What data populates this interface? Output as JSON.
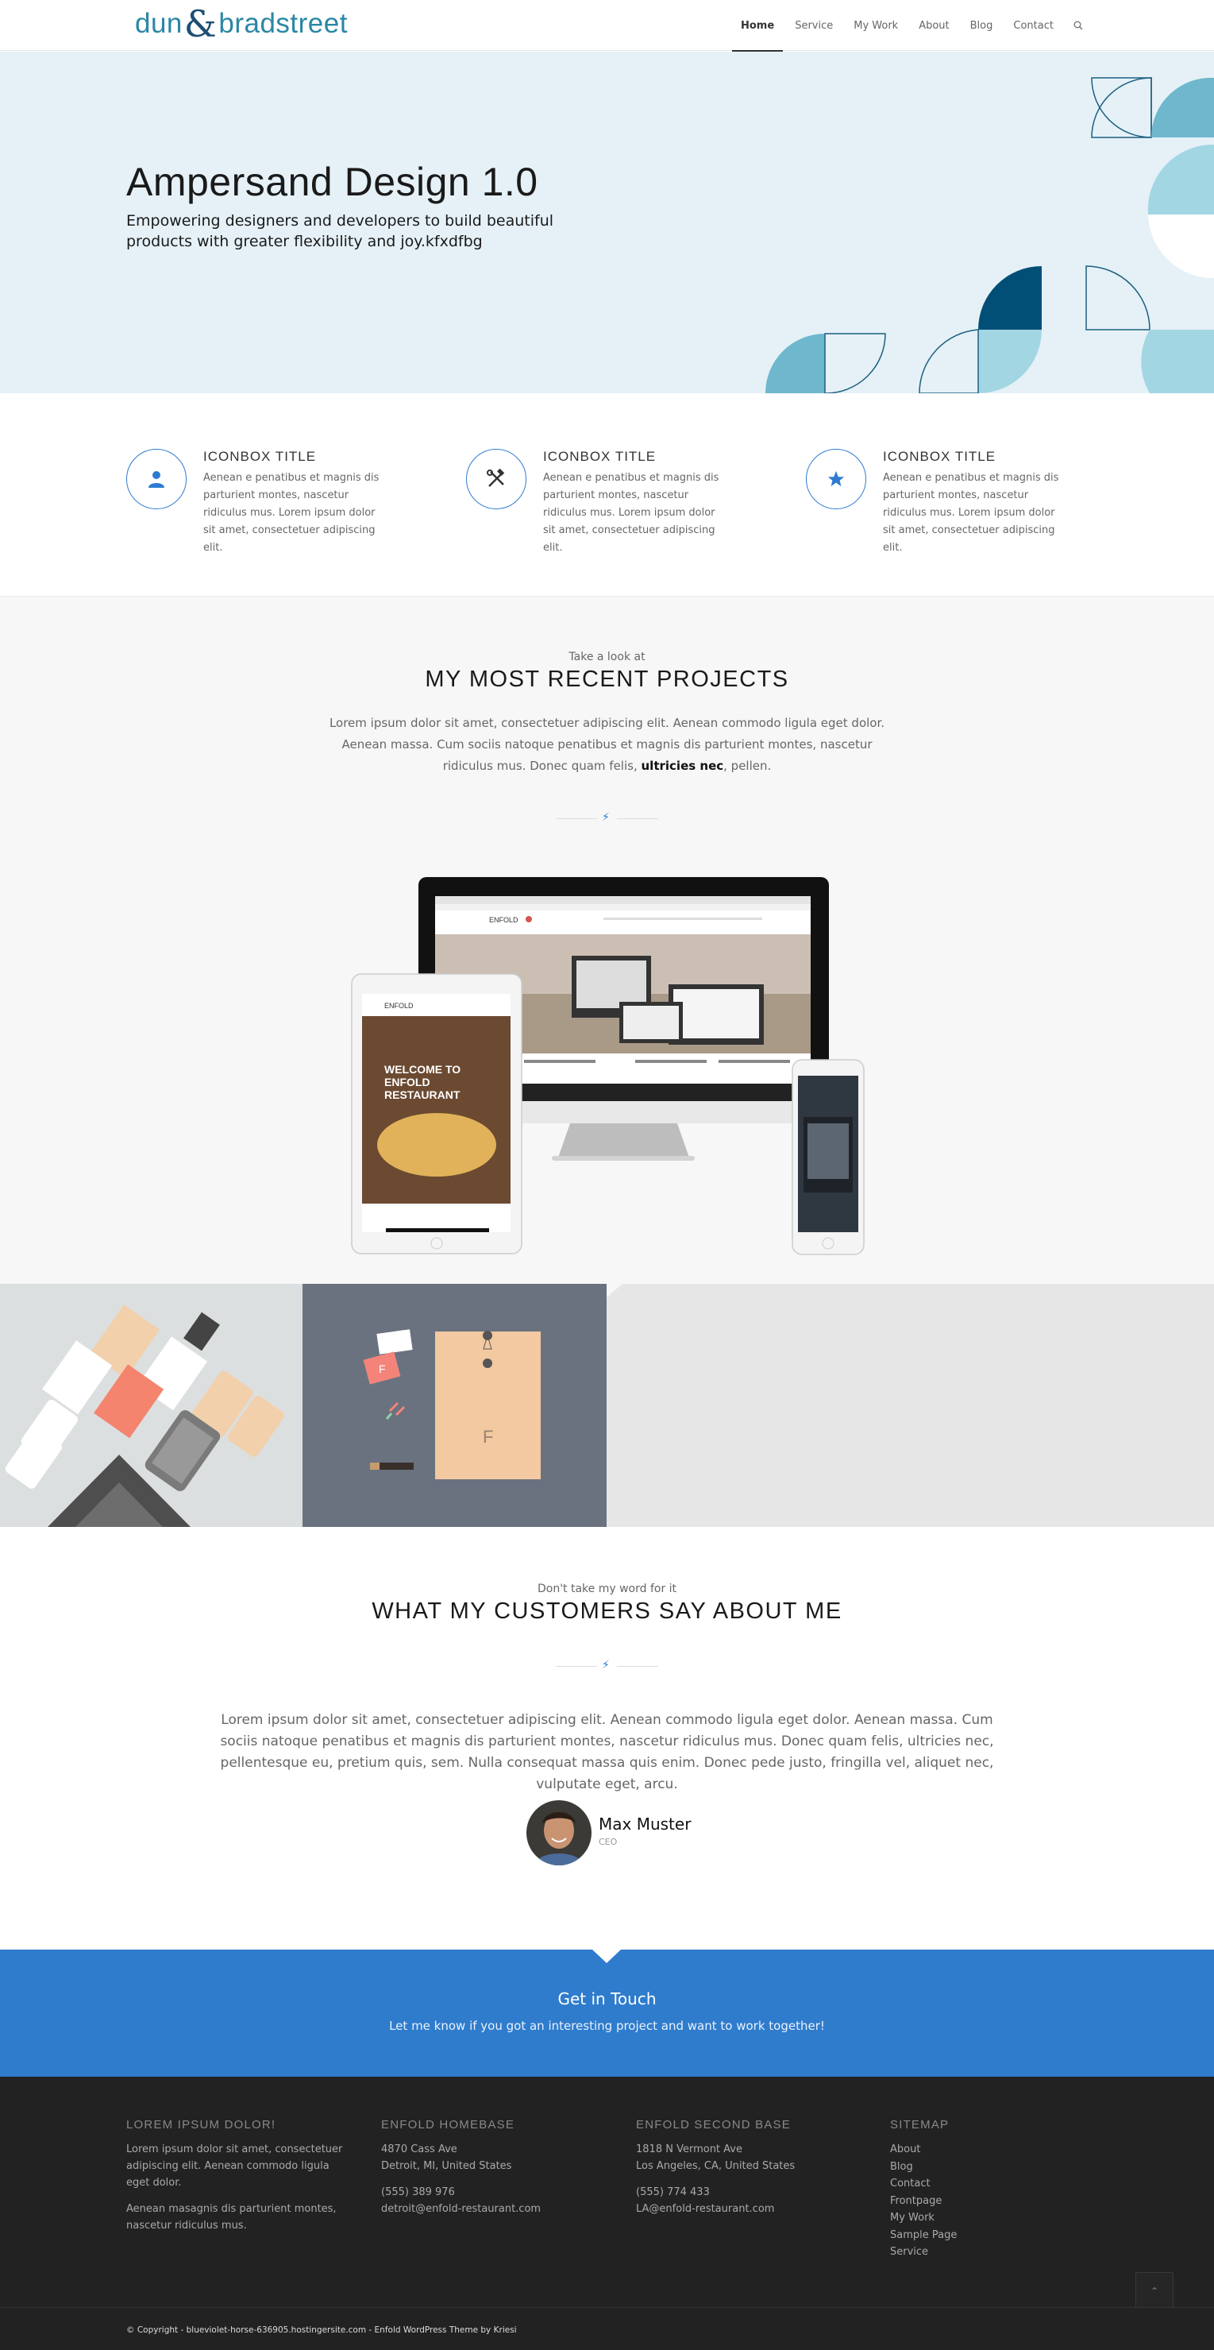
{
  "header": {
    "logo": {
      "left": "dun",
      "amp": "&",
      "right": "bradstreet"
    },
    "nav": [
      "Home",
      "Service",
      "My Work",
      "About",
      "Blog",
      "Contact"
    ],
    "search_icon": "search-icon"
  },
  "hero": {
    "title": "Ampersand Design 1.0",
    "subtitle": "Empowering designers and developers to build beautiful products with greater flexibility and joy.kfxdfbg"
  },
  "iconboxes": [
    {
      "icon": "user-icon",
      "title": "ICONBOX TITLE",
      "text": "Aenean e penatibus et magnis dis parturient montes, nascetur ridiculus mus. Lorem ipsum dolor sit amet, consectetuer adipiscing elit."
    },
    {
      "icon": "tools-icon",
      "title": "ICONBOX TITLE",
      "text": "Aenean e penatibus et magnis dis parturient montes, nascetur ridiculus mus. Lorem ipsum dolor sit amet, consectetuer adipiscing elit."
    },
    {
      "icon": "star-icon",
      "title": "ICONBOX TITLE",
      "text": "Aenean e penatibus et magnis dis parturient montes, nascetur ridiculus mus. Lorem ipsum dolor sit amet, consectetuer adipiscing elit."
    }
  ],
  "projects": {
    "kicker": "Take a look at",
    "title": "MY MOST RECENT PROJECTS",
    "lead_a": "Lorem ipsum dolor sit amet, consectetuer adipiscing elit. Aenean commodo ligula eget dolor. Aenean massa. Cum sociis natoque penatibus et magnis dis parturient montes, nascetur ridiculus mus. Donec quam felis, ",
    "lead_bold": "ultricies nec",
    "lead_b": ", pellen.",
    "divider_icon": "lightning-icon",
    "screen": {
      "logo": "ENFOLD",
      "tablet_welcome": "WELCOME TO ENFOLD RESTAURANT"
    }
  },
  "gallery": {
    "tiles": [
      "branding-tags-photo",
      "stationery-envelope-photo",
      "empty-gray-tile"
    ]
  },
  "testimonials": {
    "kicker": "Don't take my word for it",
    "title": "WHAT MY CUSTOMERS SAY ABOUT ME",
    "quote": "Lorem ipsum dolor sit amet, consectetuer adipiscing elit. Aenean commodo ligula eget dolor. Aenean massa. Cum sociis natoque penatibus et magnis dis parturient montes, nascetur ridiculus mus. Donec quam felis, ultricies nec, pellentesque eu, pretium quis, sem. Nulla consequat massa quis enim. Donec pede justo, fringilla vel, aliquet nec, vulputate eget, arcu.",
    "name": "Max Muster",
    "role": "CEO"
  },
  "cta": {
    "title": "Get in Touch",
    "text": "Let me know if you got an interesting project and want to work together!"
  },
  "footer": {
    "col1": {
      "title": "LOREM IPSUM DOLOR!",
      "p1": "Lorem ipsum dolor sit amet, consectetuer adipiscing elit. Aenean commodo ligula eget dolor.",
      "p2": "Aenean masagnis dis parturient montes, nascetur ridiculus mus."
    },
    "col2": {
      "title": "ENFOLD HOMEBASE",
      "addr1": "4870 Cass Ave",
      "addr2": "Detroit, MI, United States",
      "phone": "(555) 389 976",
      "email": "detroit@enfold-restaurant.com"
    },
    "col3": {
      "title": "ENFOLD SECOND BASE",
      "addr1": "1818 N Vermont Ave",
      "addr2": "Los Angeles, CA, United States",
      "phone": "(555) 774 433",
      "email": "LA@enfold-restaurant.com"
    },
    "col4": {
      "title": "SITEMAP",
      "links": [
        "About",
        "Blog",
        "Contact",
        "Frontpage",
        "My Work",
        "Sample Page",
        "Service"
      ]
    }
  },
  "socket": {
    "copyright": "© Copyright - blueviolet-horse-636905.hostingersite.com - Enfold WordPress Theme by Kriesi"
  },
  "colors": {
    "accent": "#2f7ccd",
    "hero_bg": "#e5f1f7",
    "footer_bg": "#222222",
    "logo_teal": "#2a87a5",
    "logo_navy": "#1d4f73"
  }
}
